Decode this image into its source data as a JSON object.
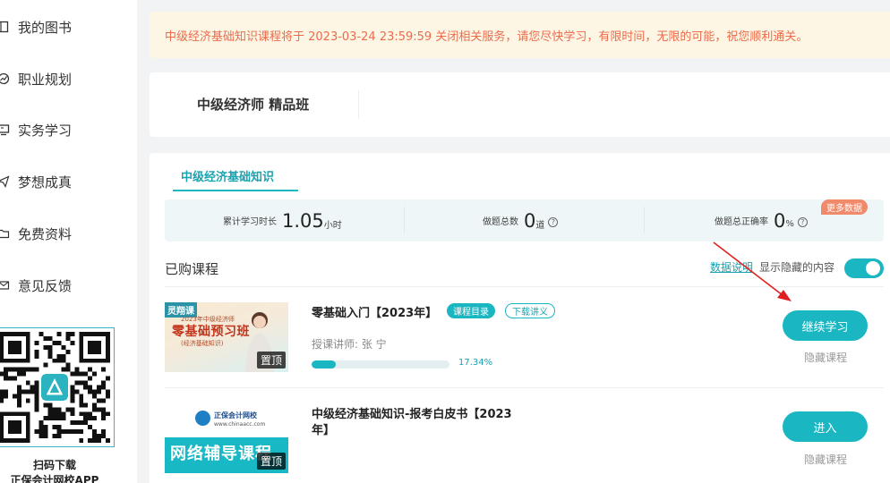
{
  "sidebar": {
    "items": [
      {
        "label": "我的图书",
        "icon": "book-icon"
      },
      {
        "label": "职业规划",
        "icon": "chart-icon"
      },
      {
        "label": "实务学习",
        "icon": "monitor-icon"
      },
      {
        "label": "梦想成真",
        "icon": "paper-plane-icon"
      },
      {
        "label": "免费资料",
        "icon": "folder-icon"
      },
      {
        "label": "意见反馈",
        "icon": "mail-icon"
      }
    ],
    "qr_caption_line1": "扫码下载",
    "qr_caption_line2": "正保会计网校APP"
  },
  "notice": {
    "text": "中级经济基础知识课程将于 2023-03-24 23:59:59 关闭相关服务，请您尽快学习，有限时间，无限的可能，祝您顺利通关。"
  },
  "class_card": {
    "title": "中级经济师 精品班"
  },
  "panel": {
    "subject_tab": "中级经济基础知识",
    "stats": {
      "study_label": "累计学习时长",
      "study_value": "1.05",
      "study_unit": "小时",
      "questions_label": "做题总数",
      "questions_value": "0",
      "questions_unit": "道",
      "accuracy_label": "做题总正确率",
      "accuracy_value": "0",
      "accuracy_unit": "%",
      "help_glyph": "?",
      "more_badge": "更多数据"
    },
    "purchased_label": "已购课程",
    "data_link": "数据说明",
    "show_hidden_label": "显示隐藏的内容",
    "show_hidden_on": true,
    "courses": [
      {
        "title": "零基础入门【2023年】",
        "tag_catalog": "课程目录",
        "tag_download": "下载讲义",
        "teacher": "授课讲师: 张 宁",
        "progress_percent": 17.34,
        "progress_label": "17.34%",
        "button": "继续学习",
        "hide": "隐藏课程",
        "thumb_tag": "置顶",
        "thumb_badge": "灵翔课",
        "thumb_line1": "2023年中级经济师",
        "thumb_big": "零基础预习班",
        "thumb_line2": "(经济基础知识)"
      },
      {
        "title_line1": "中级经济基础知识-报考白皮书【2023",
        "title_line2": "年】",
        "button": "进入",
        "hide": "隐藏课程",
        "thumb_tag": "置顶",
        "thumb_brand": "正保会计网校",
        "thumb_url": "www.chinaacc.com",
        "thumb_big": "网络辅导课程"
      }
    ]
  },
  "colors": {
    "accent": "#1ab6c2",
    "notice_bg": "#fdf6e4",
    "notice_text": "#ec6b4b",
    "badge": "#f08a6a",
    "arrow": "#e02020"
  }
}
